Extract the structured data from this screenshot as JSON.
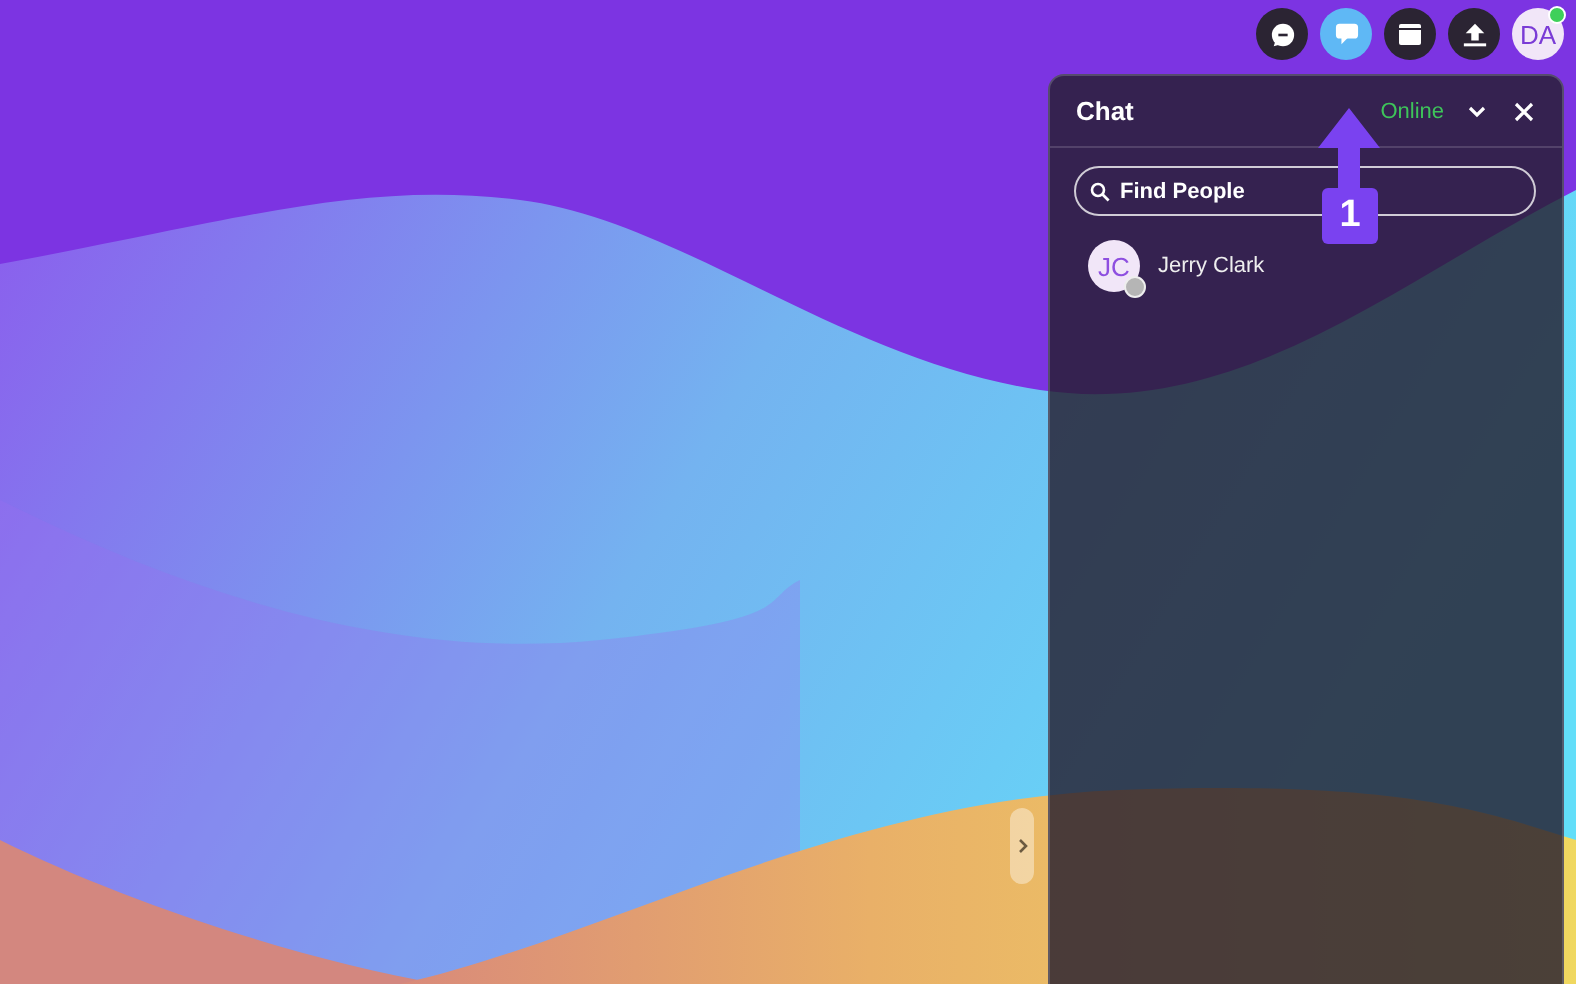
{
  "toolbar": [
    {
      "kind": "messenger",
      "selected": false
    },
    {
      "kind": "chat",
      "selected": true
    },
    {
      "kind": "calendar",
      "selected": false
    },
    {
      "kind": "upload",
      "selected": false
    }
  ],
  "user": {
    "initials": "DA",
    "online": true
  },
  "chat": {
    "title": "Chat",
    "status": "Online",
    "search": {
      "placeholder": "Find People"
    },
    "contacts": [
      {
        "initials": "JC",
        "name": "Jerry Clark",
        "online": false
      }
    ]
  },
  "annotation": {
    "label": "1"
  }
}
